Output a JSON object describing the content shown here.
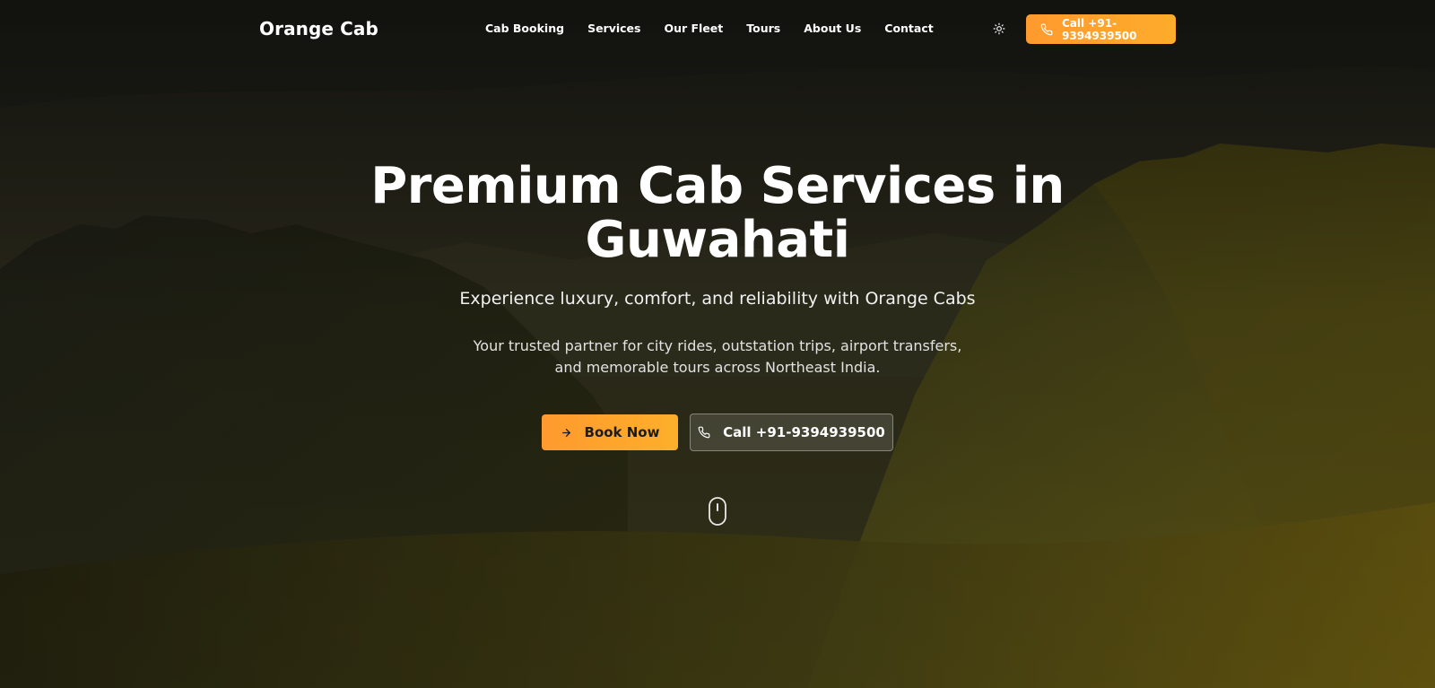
{
  "header": {
    "brand": "Orange Cab",
    "nav": [
      {
        "label": "Cab Booking"
      },
      {
        "label": "Services"
      },
      {
        "label": "Our Fleet"
      },
      {
        "label": "Tours"
      },
      {
        "label": "About Us"
      },
      {
        "label": "Contact"
      }
    ],
    "theme_toggle_icon": "sun-icon",
    "call_button": {
      "label": "Call +91-9394939500",
      "icon": "phone-icon"
    }
  },
  "hero": {
    "title_line1": "Premium Cab Services in",
    "title_line2": "Guwahati",
    "subtitle": "Experience luxury, comfort, and reliability with Orange Cabs",
    "description": "Your trusted partner for city rides, outstation trips, airport transfers, and memorable tours across Northeast India.",
    "book_button": {
      "label": "Book Now",
      "icon": "arrow-right-icon"
    },
    "call_button": {
      "label": "Call +91-9394939500",
      "icon": "phone-icon"
    },
    "scroll_icon": "mouse-scroll-icon"
  },
  "colors": {
    "accent": "#ff9a2e",
    "accent_end": "#fdaf2a",
    "text": "#ffffff"
  }
}
